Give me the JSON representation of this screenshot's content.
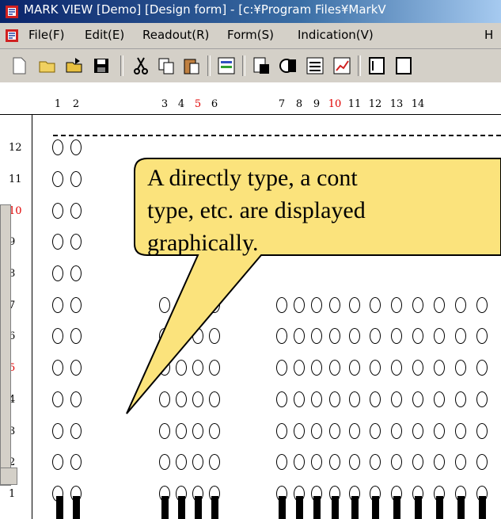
{
  "window": {
    "title": "MARK VIEW [Demo] [Design form] - [c:¥Program Files¥MarkV"
  },
  "menu": [
    "File(F)",
    "Edit(E)",
    "Readout(R)",
    "Form(S)",
    "Indication(V)",
    "H"
  ],
  "toolbar": {
    "buttons": [
      "new-icon",
      "open-icon",
      "open-folder-icon",
      "save-icon",
      "cut-icon",
      "copy-icon",
      "paste-icon",
      "form-icon",
      "read-icon",
      "mark-icon",
      "settings-icon",
      "chart-icon",
      "page-icon"
    ]
  },
  "columns": {
    "labels": [
      "1",
      "2",
      "3",
      "4",
      "5",
      "6",
      "7",
      "8",
      "9",
      "10",
      "11",
      "12",
      "13",
      "14"
    ],
    "highlighted": [
      "5",
      "10"
    ],
    "highlight_color": "#e00000"
  },
  "rows": {
    "labels": [
      "12",
      "11",
      "10",
      "9",
      "8",
      "7",
      "6",
      "5",
      "4",
      "3",
      "2",
      "1"
    ],
    "highlighted": [
      "10",
      "5"
    ]
  },
  "callout": {
    "text": "A directly type, a cont\ntype, etc. are displayed\ngraphically.",
    "fill": "#fbe37c"
  }
}
